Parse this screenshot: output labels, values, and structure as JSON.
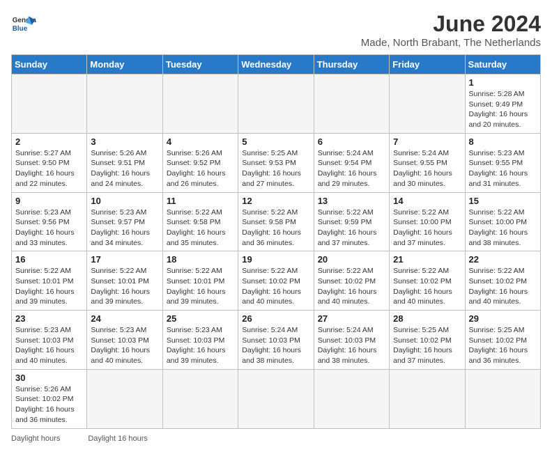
{
  "header": {
    "logo_general": "General",
    "logo_blue": "Blue",
    "month_title": "June 2024",
    "subtitle": "Made, North Brabant, The Netherlands"
  },
  "days_of_week": [
    "Sunday",
    "Monday",
    "Tuesday",
    "Wednesday",
    "Thursday",
    "Friday",
    "Saturday"
  ],
  "weeks": [
    [
      {
        "day": "",
        "info": ""
      },
      {
        "day": "",
        "info": ""
      },
      {
        "day": "",
        "info": ""
      },
      {
        "day": "",
        "info": ""
      },
      {
        "day": "",
        "info": ""
      },
      {
        "day": "",
        "info": ""
      },
      {
        "day": "1",
        "info": "Sunrise: 5:28 AM\nSunset: 9:49 PM\nDaylight: 16 hours\nand 20 minutes."
      }
    ],
    [
      {
        "day": "2",
        "info": "Sunrise: 5:27 AM\nSunset: 9:50 PM\nDaylight: 16 hours\nand 22 minutes."
      },
      {
        "day": "3",
        "info": "Sunrise: 5:26 AM\nSunset: 9:51 PM\nDaylight: 16 hours\nand 24 minutes."
      },
      {
        "day": "4",
        "info": "Sunrise: 5:26 AM\nSunset: 9:52 PM\nDaylight: 16 hours\nand 26 minutes."
      },
      {
        "day": "5",
        "info": "Sunrise: 5:25 AM\nSunset: 9:53 PM\nDaylight: 16 hours\nand 27 minutes."
      },
      {
        "day": "6",
        "info": "Sunrise: 5:24 AM\nSunset: 9:54 PM\nDaylight: 16 hours\nand 29 minutes."
      },
      {
        "day": "7",
        "info": "Sunrise: 5:24 AM\nSunset: 9:55 PM\nDaylight: 16 hours\nand 30 minutes."
      },
      {
        "day": "8",
        "info": "Sunrise: 5:23 AM\nSunset: 9:55 PM\nDaylight: 16 hours\nand 31 minutes."
      }
    ],
    [
      {
        "day": "9",
        "info": "Sunrise: 5:23 AM\nSunset: 9:56 PM\nDaylight: 16 hours\nand 33 minutes."
      },
      {
        "day": "10",
        "info": "Sunrise: 5:23 AM\nSunset: 9:57 PM\nDaylight: 16 hours\nand 34 minutes."
      },
      {
        "day": "11",
        "info": "Sunrise: 5:22 AM\nSunset: 9:58 PM\nDaylight: 16 hours\nand 35 minutes."
      },
      {
        "day": "12",
        "info": "Sunrise: 5:22 AM\nSunset: 9:58 PM\nDaylight: 16 hours\nand 36 minutes."
      },
      {
        "day": "13",
        "info": "Sunrise: 5:22 AM\nSunset: 9:59 PM\nDaylight: 16 hours\nand 37 minutes."
      },
      {
        "day": "14",
        "info": "Sunrise: 5:22 AM\nSunset: 10:00 PM\nDaylight: 16 hours\nand 37 minutes."
      },
      {
        "day": "15",
        "info": "Sunrise: 5:22 AM\nSunset: 10:00 PM\nDaylight: 16 hours\nand 38 minutes."
      }
    ],
    [
      {
        "day": "16",
        "info": "Sunrise: 5:22 AM\nSunset: 10:01 PM\nDaylight: 16 hours\nand 39 minutes."
      },
      {
        "day": "17",
        "info": "Sunrise: 5:22 AM\nSunset: 10:01 PM\nDaylight: 16 hours\nand 39 minutes."
      },
      {
        "day": "18",
        "info": "Sunrise: 5:22 AM\nSunset: 10:01 PM\nDaylight: 16 hours\nand 39 minutes."
      },
      {
        "day": "19",
        "info": "Sunrise: 5:22 AM\nSunset: 10:02 PM\nDaylight: 16 hours\nand 40 minutes."
      },
      {
        "day": "20",
        "info": "Sunrise: 5:22 AM\nSunset: 10:02 PM\nDaylight: 16 hours\nand 40 minutes."
      },
      {
        "day": "21",
        "info": "Sunrise: 5:22 AM\nSunset: 10:02 PM\nDaylight: 16 hours\nand 40 minutes."
      },
      {
        "day": "22",
        "info": "Sunrise: 5:22 AM\nSunset: 10:02 PM\nDaylight: 16 hours\nand 40 minutes."
      }
    ],
    [
      {
        "day": "23",
        "info": "Sunrise: 5:23 AM\nSunset: 10:03 PM\nDaylight: 16 hours\nand 40 minutes."
      },
      {
        "day": "24",
        "info": "Sunrise: 5:23 AM\nSunset: 10:03 PM\nDaylight: 16 hours\nand 40 minutes."
      },
      {
        "day": "25",
        "info": "Sunrise: 5:23 AM\nSunset: 10:03 PM\nDaylight: 16 hours\nand 39 minutes."
      },
      {
        "day": "26",
        "info": "Sunrise: 5:24 AM\nSunset: 10:03 PM\nDaylight: 16 hours\nand 38 minutes."
      },
      {
        "day": "27",
        "info": "Sunrise: 5:24 AM\nSunset: 10:03 PM\nDaylight: 16 hours\nand 38 minutes."
      },
      {
        "day": "28",
        "info": "Sunrise: 5:25 AM\nSunset: 10:02 PM\nDaylight: 16 hours\nand 37 minutes."
      },
      {
        "day": "29",
        "info": "Sunrise: 5:25 AM\nSunset: 10:02 PM\nDaylight: 16 hours\nand 36 minutes."
      }
    ],
    [
      {
        "day": "30",
        "info": "Sunrise: 5:26 AM\nSunset: 10:02 PM\nDaylight: 16 hours\nand 36 minutes."
      },
      {
        "day": "",
        "info": ""
      },
      {
        "day": "",
        "info": ""
      },
      {
        "day": "",
        "info": ""
      },
      {
        "day": "",
        "info": ""
      },
      {
        "day": "",
        "info": ""
      },
      {
        "day": "",
        "info": ""
      }
    ]
  ],
  "footer": {
    "left": "Daylight hours",
    "right": "Daylight 16 hours"
  }
}
